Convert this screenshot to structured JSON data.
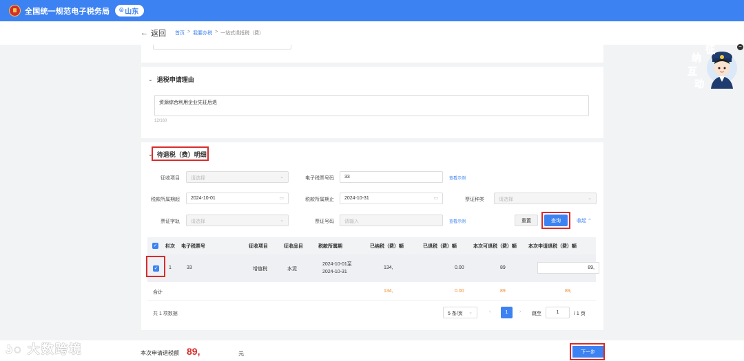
{
  "header": {
    "brand": "全国统一规范电子税务局",
    "region": "山东"
  },
  "nav": {
    "back": "返回",
    "crumbs": [
      "首页",
      "我要办税",
      "一站式退抵税（费）"
    ]
  },
  "reason": {
    "title": "退税申请理由",
    "text": "资源综合利用企业先征后退",
    "counter": "12/160"
  },
  "detail": {
    "title": "待退税（费）明细",
    "filters": {
      "levy_item_label": "征收项目",
      "levy_item_ph": "请选择",
      "eticket_label": "电子税票号码",
      "eticket_value": "33",
      "view_example": "查看示例",
      "period_start_label": "税款所属期起",
      "period_start": "2024-10-01",
      "period_end_label": "税款所属期止",
      "period_end": "2024-10-31",
      "voucher_type_label": "票证种类",
      "voucher_type_ph": "请选择",
      "voucher_track_label": "票证字轨",
      "voucher_track_ph": "请选择",
      "voucher_no_label": "票证号码",
      "voucher_no_ph": "请输入",
      "reset": "重置",
      "query": "查询",
      "collapse": "收起"
    },
    "table": {
      "headers": [
        "栏次",
        "电子税票号",
        "征收项目",
        "征收品目",
        "税款所属期",
        "已纳税（费）额",
        "已退税（费）额",
        "本次可退税（费）额",
        "本次申请退税（费）额"
      ],
      "row": {
        "no": "1",
        "eticket": "33",
        "item": "增值税",
        "sub": "水泥",
        "period1": "2024-10-01至",
        "period2": "2024-10-31",
        "paid": "134,",
        "refunded": "0.00",
        "refundable": "89",
        "apply": "89,"
      },
      "total": {
        "label": "合计",
        "paid": "134,",
        "refunded": "0.00",
        "refundable": "89",
        "apply": "89,"
      }
    },
    "pagination": {
      "count": "共 1 项数据",
      "size": "5 条/页",
      "current": "1",
      "goto": "跳至",
      "goto_value": "1",
      "total_pages": "/ 1 页"
    }
  },
  "footer": {
    "label": "本次申请退税额",
    "amount": "89,",
    "unit": "元",
    "next": "下一步"
  },
  "watermark": "大数跨境",
  "mascot": {
    "chars": [
      "征",
      "纳",
      "互",
      "动"
    ]
  },
  "colors": {
    "primary": "#3d82f2",
    "highlight": "#d92b2b",
    "accent": "#f08b2e"
  }
}
